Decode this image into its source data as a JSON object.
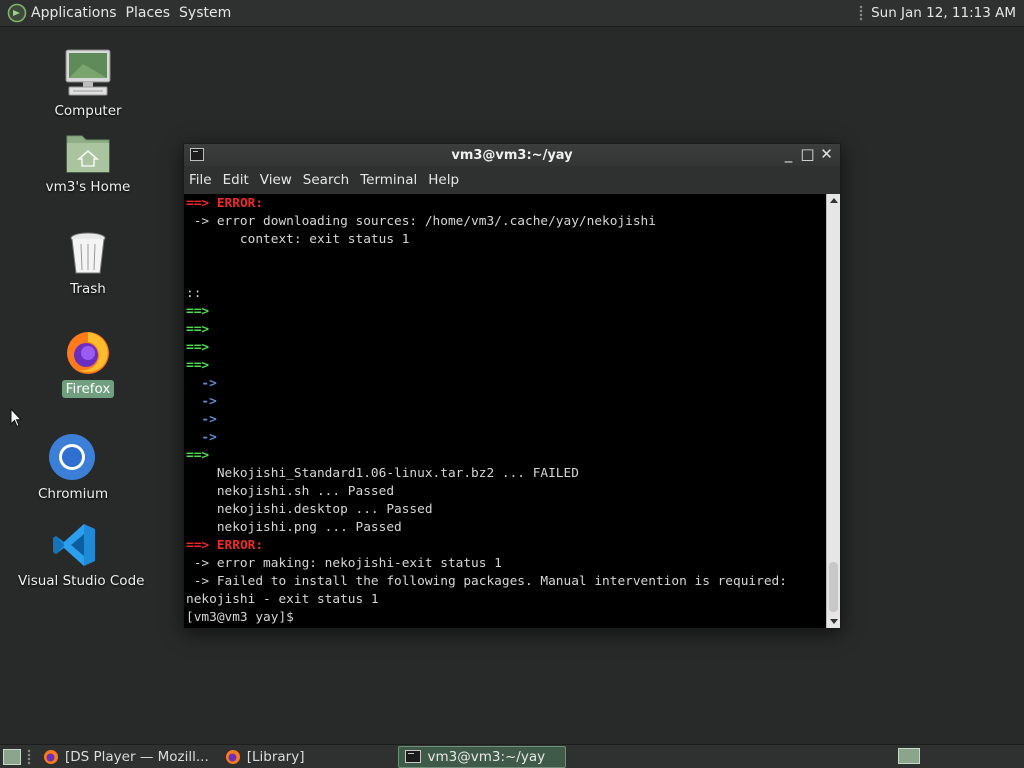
{
  "top_panel": {
    "menus": [
      "Applications",
      "Places",
      "System"
    ],
    "clock": "Sun Jan 12, 11:13 AM"
  },
  "desktop": {
    "icons": [
      {
        "label": "Computer",
        "icon": "computer-icon"
      },
      {
        "label": "vm3's Home",
        "icon": "home-folder-icon"
      },
      {
        "label": "Trash",
        "icon": "trash-icon"
      },
      {
        "label": "Firefox",
        "icon": "firefox-icon",
        "selected": true
      },
      {
        "label": "Chromium",
        "icon": "chromium-icon"
      },
      {
        "label": "Visual Studio Code",
        "icon": "vscode-icon"
      }
    ]
  },
  "terminal": {
    "title": "vm3@vm3:~/yay",
    "menu": [
      "File",
      "Edit",
      "View",
      "Search",
      "Terminal",
      "Help"
    ],
    "lines": [
      [
        {
          "t": "==> ",
          "c": "red"
        },
        {
          "t": "ERROR:",
          "c": "red"
        }
      ],
      [
        {
          "t": " -> error downloading sources: /home/vm3/.cache/yay/nekojishi"
        }
      ],
      [
        {
          "t": "       context: exit status 1"
        }
      ],
      [
        {
          "t": ""
        }
      ],
      [
        {
          "t": ""
        }
      ],
      [
        {
          "t": "::"
        }
      ],
      [
        {
          "t": "==>",
          "c": "green"
        }
      ],
      [
        {
          "t": "==>",
          "c": "green"
        }
      ],
      [
        {
          "t": "==>",
          "c": "green"
        }
      ],
      [
        {
          "t": "==>",
          "c": "green"
        }
      ],
      [
        {
          "t": "  "
        },
        {
          "t": "->",
          "c": "blue"
        }
      ],
      [
        {
          "t": "  "
        },
        {
          "t": "->",
          "c": "blue"
        }
      ],
      [
        {
          "t": "  "
        },
        {
          "t": "->",
          "c": "blue"
        }
      ],
      [
        {
          "t": "  "
        },
        {
          "t": "->",
          "c": "blue"
        }
      ],
      [
        {
          "t": "==>",
          "c": "green"
        }
      ],
      [
        {
          "t": "    Nekojishi_Standard1.06-linux.tar.bz2 ... FAILED"
        }
      ],
      [
        {
          "t": "    nekojishi.sh ... Passed"
        }
      ],
      [
        {
          "t": "    nekojishi.desktop ... Passed"
        }
      ],
      [
        {
          "t": "    nekojishi.png ... Passed"
        }
      ],
      [
        {
          "t": "==> ",
          "c": "red"
        },
        {
          "t": "ERROR:",
          "c": "red"
        }
      ],
      [
        {
          "t": " -> error making: nekojishi-exit status 1"
        }
      ],
      [
        {
          "t": " -> Failed to install the following packages. Manual intervention is required:"
        }
      ],
      [
        {
          "t": "nekojishi - exit status 1"
        }
      ],
      [
        {
          "t": "[vm3@vm3 yay]$ "
        }
      ]
    ]
  },
  "taskbar": {
    "tasks": [
      {
        "label": "[DS Player — Mozill...",
        "icon": "firefox-icon",
        "active": false
      },
      {
        "label": "[Library]",
        "icon": "firefox-icon",
        "active": false
      },
      {
        "label": "vm3@vm3:~/yay",
        "icon": "terminal-icon",
        "active": true
      }
    ]
  },
  "colors": {
    "accent": "#6f9f7f",
    "error_red": "#ef2929",
    "prompt_green": "#4fe04f",
    "arrow_blue": "#5d8fd6"
  }
}
